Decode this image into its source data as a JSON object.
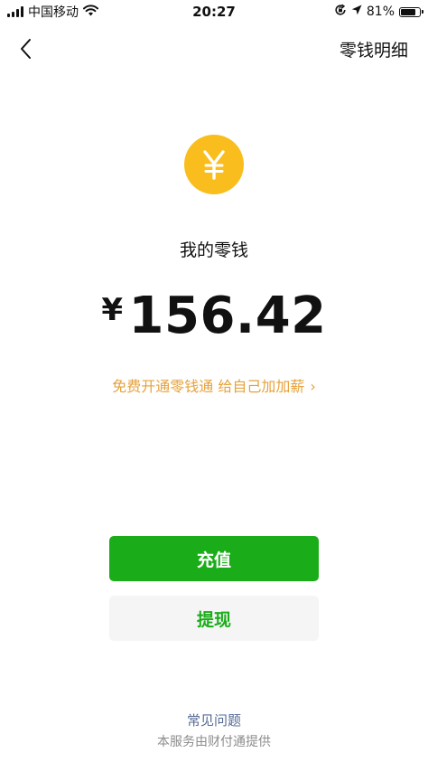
{
  "status_bar": {
    "carrier": "中国移动",
    "time": "20:27",
    "battery_percent": "81%",
    "battery_level": 0.81,
    "icons": [
      "signal-icon",
      "wifi-icon",
      "orientation-lock-icon",
      "location-icon",
      "battery-icon"
    ]
  },
  "nav": {
    "back_icon": "chevron-left-icon",
    "action_label": "零钱明细"
  },
  "balance": {
    "coin_symbol": "¥",
    "label": "我的零钱",
    "currency": "¥",
    "amount": "156.42"
  },
  "promo": {
    "text": "免费开通零钱通 给自己加加薪",
    "chevron": "›"
  },
  "actions": {
    "recharge_label": "充值",
    "withdraw_label": "提现"
  },
  "footer": {
    "faq_label": "常见问题",
    "provider_note": "本服务由财付通提供"
  },
  "colors": {
    "primary_green": "#1AAD19",
    "coin_yellow": "#F9BE1E",
    "promo_orange": "#E6A23C",
    "link_blue": "#576B95",
    "secondary_bg": "#F5F5F5"
  }
}
